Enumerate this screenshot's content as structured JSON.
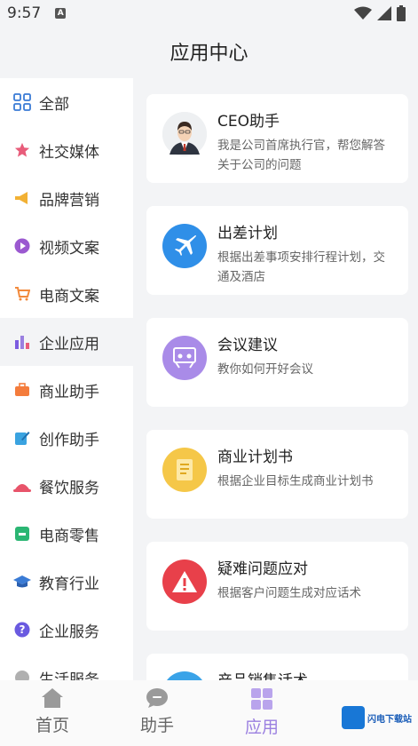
{
  "status": {
    "time": "9:57",
    "notif": "A"
  },
  "header": {
    "title": "应用中心"
  },
  "sidebar": {
    "items": [
      {
        "label": "全部",
        "icon": "grid-icon",
        "color": "#3a7bd5"
      },
      {
        "label": "社交媒体",
        "icon": "star-icon",
        "color": "#e85c7a"
      },
      {
        "label": "品牌营销",
        "icon": "megaphone-icon",
        "color": "#f2b134"
      },
      {
        "label": "视频文案",
        "icon": "play-icon",
        "color": "#9b59d0"
      },
      {
        "label": "电商文案",
        "icon": "cart-icon",
        "color": "#f28a3c"
      },
      {
        "label": "企业应用",
        "icon": "bar-chart-icon",
        "color": "#7c5ce0"
      },
      {
        "label": "商业助手",
        "icon": "briefcase-icon",
        "color": "#f47c3c"
      },
      {
        "label": "创作助手",
        "icon": "edit-icon",
        "color": "#3aa3e0"
      },
      {
        "label": "餐饮服务",
        "icon": "dish-icon",
        "color": "#e8546a"
      },
      {
        "label": "电商零售",
        "icon": "shop-icon",
        "color": "#2bb673"
      },
      {
        "label": "教育行业",
        "icon": "graduation-cap-icon",
        "color": "#3a7bd5"
      },
      {
        "label": "企业服务",
        "icon": "help-icon",
        "color": "#6a5ae0"
      },
      {
        "label": "生活服务",
        "icon": "life-icon",
        "color": "#9a9a9a"
      }
    ]
  },
  "cards": [
    {
      "title": "CEO助手",
      "desc": "我是公司首席执行官，帮您解答关于公司的问题",
      "icon": "ceo-avatar-icon",
      "color": "#e8e8e8"
    },
    {
      "title": "出差计划",
      "desc": "根据出差事项安排行程计划，交通及酒店",
      "icon": "airplane-icon",
      "color": "#2f8fe8"
    },
    {
      "title": "会议建议",
      "desc": "教你如何开好会议",
      "icon": "meeting-icon",
      "color": "#a98be8"
    },
    {
      "title": "商业计划书",
      "desc": "根据企业目标生成商业计划书",
      "icon": "document-icon",
      "color": "#f5c748"
    },
    {
      "title": "疑难问题应对",
      "desc": "根据客户问题生成对应话术",
      "icon": "warning-icon",
      "color": "#e8404a"
    },
    {
      "title": "产品销售话术",
      "desc": "",
      "icon": "sales-icon",
      "color": "#3aa3e8"
    }
  ],
  "tabbar": {
    "tabs": [
      {
        "label": "首页",
        "icon": "home-icon"
      },
      {
        "label": "助手",
        "icon": "chat-icon"
      },
      {
        "label": "应用",
        "icon": "apps-icon"
      }
    ]
  },
  "watermark": {
    "text": "闪电下载站"
  }
}
